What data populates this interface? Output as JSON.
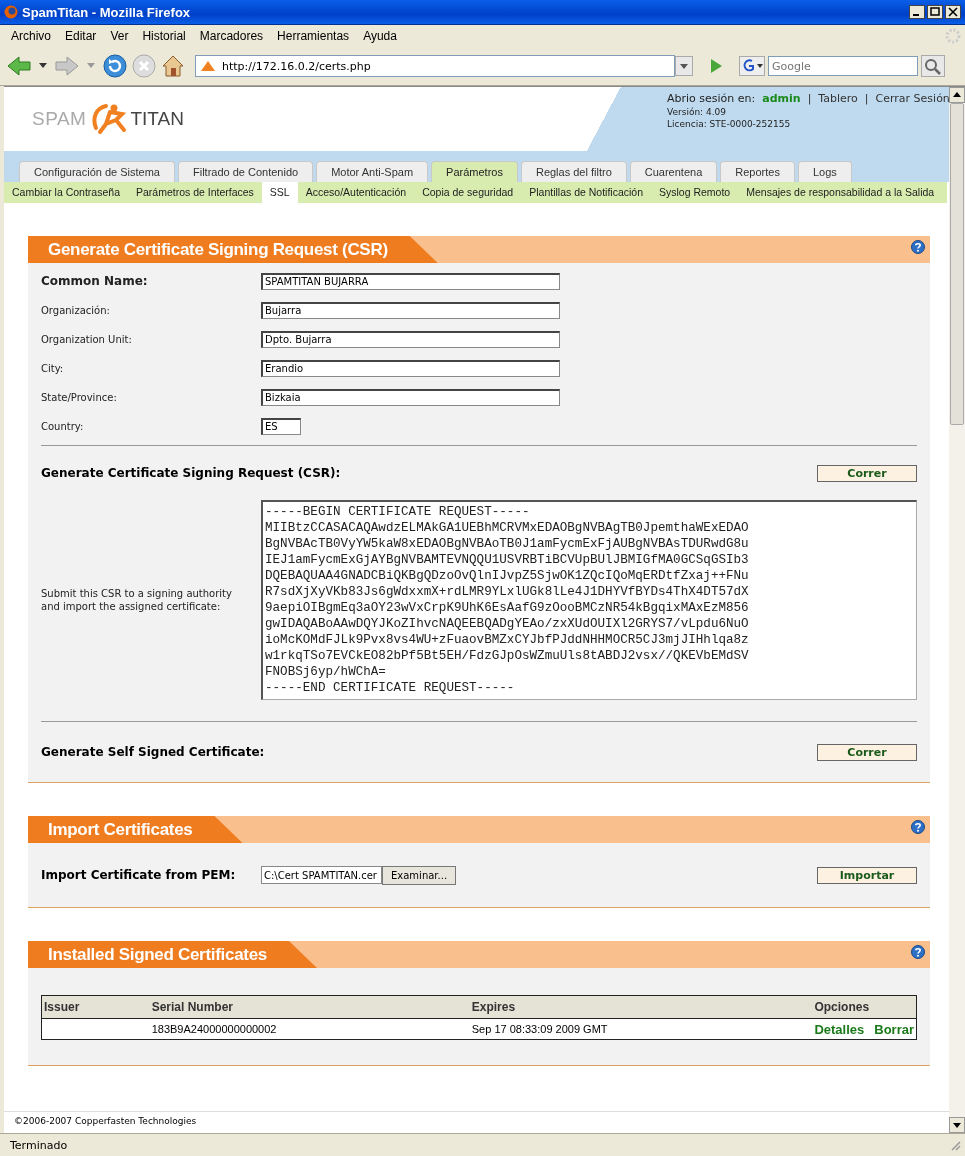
{
  "window": {
    "title": "SpamTitan - Mozilla Firefox"
  },
  "menu": [
    "Archivo",
    "Editar",
    "Ver",
    "Historial",
    "Marcadores",
    "Herramientas",
    "Ayuda"
  ],
  "toolbar": {
    "url": "http://172.16.0.2/certs.php",
    "search_placeholder": "Google"
  },
  "header": {
    "logo_left": "SPAM",
    "logo_right": "TITAN",
    "session_label": "Abrio sesión en:",
    "user": "admin",
    "links": [
      "Tablero",
      "Cerrar Sesión"
    ],
    "separator": "|",
    "version": "Versión: 4.09",
    "license": "Licencia: STE-0000-252155"
  },
  "tabs": [
    {
      "label": "Configuración de Sistema",
      "selected": false
    },
    {
      "label": "Filtrado de Contenido",
      "selected": false
    },
    {
      "label": "Motor Anti-Spam",
      "selected": false
    },
    {
      "label": "Parámetros",
      "selected": true
    },
    {
      "label": "Reglas del filtro",
      "selected": false
    },
    {
      "label": "Cuarentena",
      "selected": false
    },
    {
      "label": "Reportes",
      "selected": false
    },
    {
      "label": "Logs",
      "selected": false
    }
  ],
  "subtabs": [
    {
      "label": "Cambiar la Contraseña",
      "selected": false
    },
    {
      "label": "Parámetros de Interfaces",
      "selected": false
    },
    {
      "label": "SSL",
      "selected": true
    },
    {
      "label": "Acceso/Autenticación",
      "selected": false
    },
    {
      "label": "Copia de seguridad",
      "selected": false
    },
    {
      "label": "Plantillas de Notificación",
      "selected": false
    },
    {
      "label": "Syslog Remoto",
      "selected": false
    },
    {
      "label": "Mensajes de responsabilidad a la Salida",
      "selected": false
    }
  ],
  "csr_section": {
    "title": "Generate Certificate Signing Request (CSR)",
    "fields": [
      {
        "label": "Common Name:",
        "value": "SPAMTITAN BUJARRA",
        "kind": "main"
      },
      {
        "label": "Organización:",
        "value": "Bujarra",
        "kind": "text"
      },
      {
        "label": "Organization Unit:",
        "value": "Dpto. Bujarra",
        "kind": "text"
      },
      {
        "label": "City:",
        "value": "Erandio",
        "kind": "text"
      },
      {
        "label": "State/Province:",
        "value": "Bizkaia",
        "kind": "text"
      },
      {
        "label": "Country:",
        "value": "ES",
        "kind": "short"
      }
    ],
    "generate_label": "Generate Certificate Signing Request (CSR):",
    "generate_button": "Correr",
    "submit_note": "Submit this CSR to a signing authority and import the assigned certificate:",
    "csr_lines": [
      "-----BEGIN CERTIFICATE REQUEST-----",
      "MIIBtzCCASACAQAwdzELMAkGA1UEBhMCRVMxEDAOBgNVBAgTB0JpemthaWExEDAO",
      "BgNVBAcTB0VyYW5kaW8xEDAOBgNVBAoTB0J1amFycmExFjAUBgNVBAsTDURwdG8u",
      "IEJ1amFycmExGjAYBgNVBAMTEVNQQU1USVRBTiBCVUpBUlJBMIGfMA0GCSqGSIb3",
      "DQEBAQUAA4GNADCBiQKBgQDzoOvQlnIJvpZ5SjwOK1ZQcIQoMqERDtfZxaj++FNu",
      "R7sdXjXyVKb83Js6gWdxxmX+rdLMR9YLxlUGk8lLe4J1DHYVfBYDs4ThX4DT57dX",
      "9aepiOIBgmEq3aOY23wVxCrpK9UhK6EsAafG9zOooBMCzNR54kBgqixMAxEzM856",
      "gwIDAQABoAAwDQYJKoZIhvcNAQEEBQADgYEAo/zxXUdOUIXl2GRYS7/vLpdu6NuO",
      "ioMcKOMdFJLk9Pvx8vs4WU+zFuaovBMZxCYJbfPJddNHHMOCR5CJ3mjJIHhlqa8z",
      "w1rkqTSo7EVCkEO82bPf5Bt5EH/FdzGJpOsWZmuUls8tABDJ2vsx//QKEVbEMdSV",
      "FNOBSj6yp/hWChA=",
      "-----END CERTIFICATE REQUEST-----"
    ],
    "self_signed_label": "Generate Self Signed Certificate:",
    "self_signed_button": "Correr"
  },
  "import_section": {
    "title": "Import Certificates",
    "label": "Import Certificate from PEM:",
    "file_value": "C:\\Cert SPAMTITAN.cer",
    "browse_button": "Examinar...",
    "import_button": "Importar"
  },
  "installed_section": {
    "title": "Installed Signed Certificates",
    "columns": [
      "Issuer",
      "Serial Number",
      "Expires",
      "Opciones"
    ],
    "rows": [
      {
        "issuer": "",
        "serial": "183B9A24000000000002",
        "expires": "Sep 17 08:33:09 2009 GMT",
        "actions": [
          "Detalles",
          "Borrar"
        ]
      }
    ]
  },
  "footer": "©2006-2007 Copperfasten Technologies",
  "status_bar": "Terminado"
}
